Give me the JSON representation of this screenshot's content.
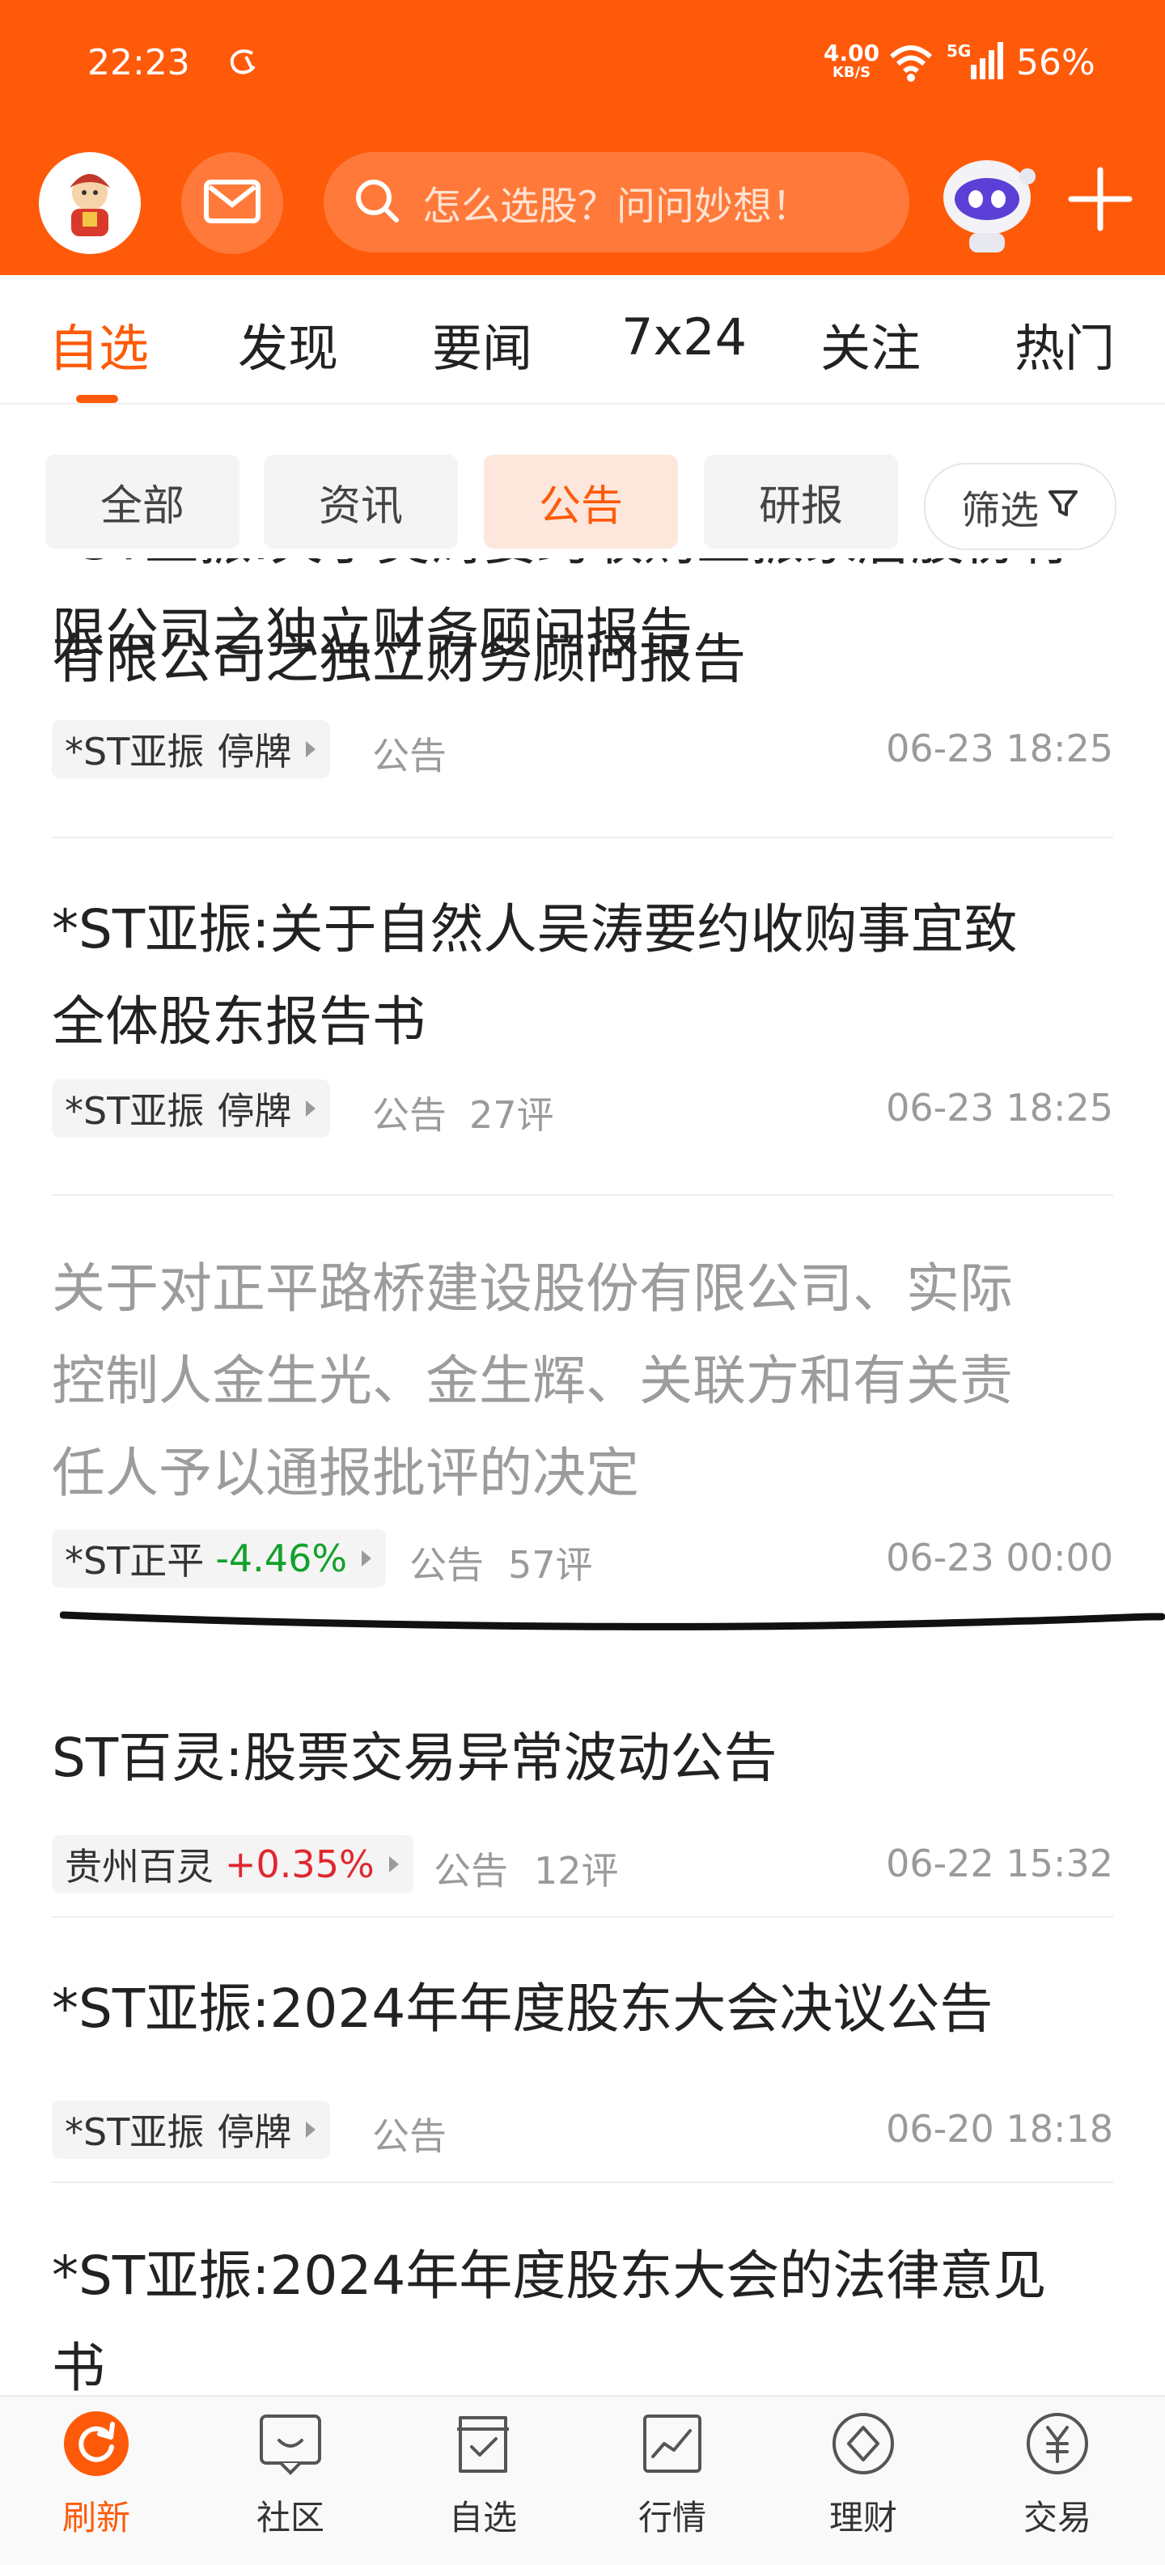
{
  "status_bar": {
    "time": "22:23",
    "net_speed_value": "4.00",
    "net_speed_unit": "KB/S",
    "signal_label": "5G",
    "battery": "56%"
  },
  "header": {
    "search_placeholder": "怎么选股？问问妙想！"
  },
  "tabs": [
    {
      "label": "自选",
      "active": true
    },
    {
      "label": "发现"
    },
    {
      "label": "要闻"
    },
    {
      "label": "7x24"
    },
    {
      "label": "关注"
    },
    {
      "label": "热门"
    }
  ],
  "chips": [
    {
      "label": "全部"
    },
    {
      "label": "资讯"
    },
    {
      "label": "公告",
      "active": true
    },
    {
      "label": "研报"
    }
  ],
  "filter_label": "筛选",
  "feed": [
    {
      "title": "*ST亚振:关于吴涛要约收购亚振家居股份有限公司之独立财务顾问报告",
      "title_visible_line": "有限公司之独立财务顾问报告",
      "tag_name": "*ST亚振",
      "tag_status": "停牌",
      "type": "公告",
      "comments": "",
      "time": "06-23 18:25"
    },
    {
      "title_line1": "*ST亚振:关于自然人吴涛要约收购事宜致",
      "title_line2": "全体股东报告书",
      "tag_name": "*ST亚振",
      "tag_status": "停牌",
      "type": "公告",
      "comments": "27评",
      "time": "06-23 18:25"
    },
    {
      "title_line1": "关于对正平路桥建设股份有限公司、实际",
      "title_line2": "控制人金生光、金生辉、关联方和有关责",
      "title_line3": "任人予以通报批评的决定",
      "tag_name": "*ST正平",
      "tag_change": "-4.46%",
      "type": "公告",
      "comments": "57评",
      "time": "06-23 00:00"
    },
    {
      "title_line1": "ST百灵:股票交易异常波动公告",
      "tag_name": "贵州百灵",
      "tag_change": "+0.35%",
      "type": "公告",
      "comments": "12评",
      "time": "06-22 15:32"
    },
    {
      "title_line1": "*ST亚振:2024年年度股东大会决议公告",
      "tag_name": "*ST亚振",
      "tag_status": "停牌",
      "type": "公告",
      "comments": "",
      "time": "06-20 18:18"
    },
    {
      "title_line1": "*ST亚振:2024年年度股东大会的法律意见",
      "title_line2": "书"
    }
  ],
  "bottom_nav": [
    {
      "label": "刷新",
      "icon": "refresh-icon",
      "active": true
    },
    {
      "label": "社区",
      "icon": "community-icon"
    },
    {
      "label": "自选",
      "icon": "watchlist-icon"
    },
    {
      "label": "行情",
      "icon": "market-icon"
    },
    {
      "label": "理财",
      "icon": "wealth-icon"
    },
    {
      "label": "交易",
      "icon": "trade-icon"
    }
  ],
  "colors": {
    "brand": "#fe5a0a",
    "down": "#12a12a",
    "up": "#e0272f"
  }
}
